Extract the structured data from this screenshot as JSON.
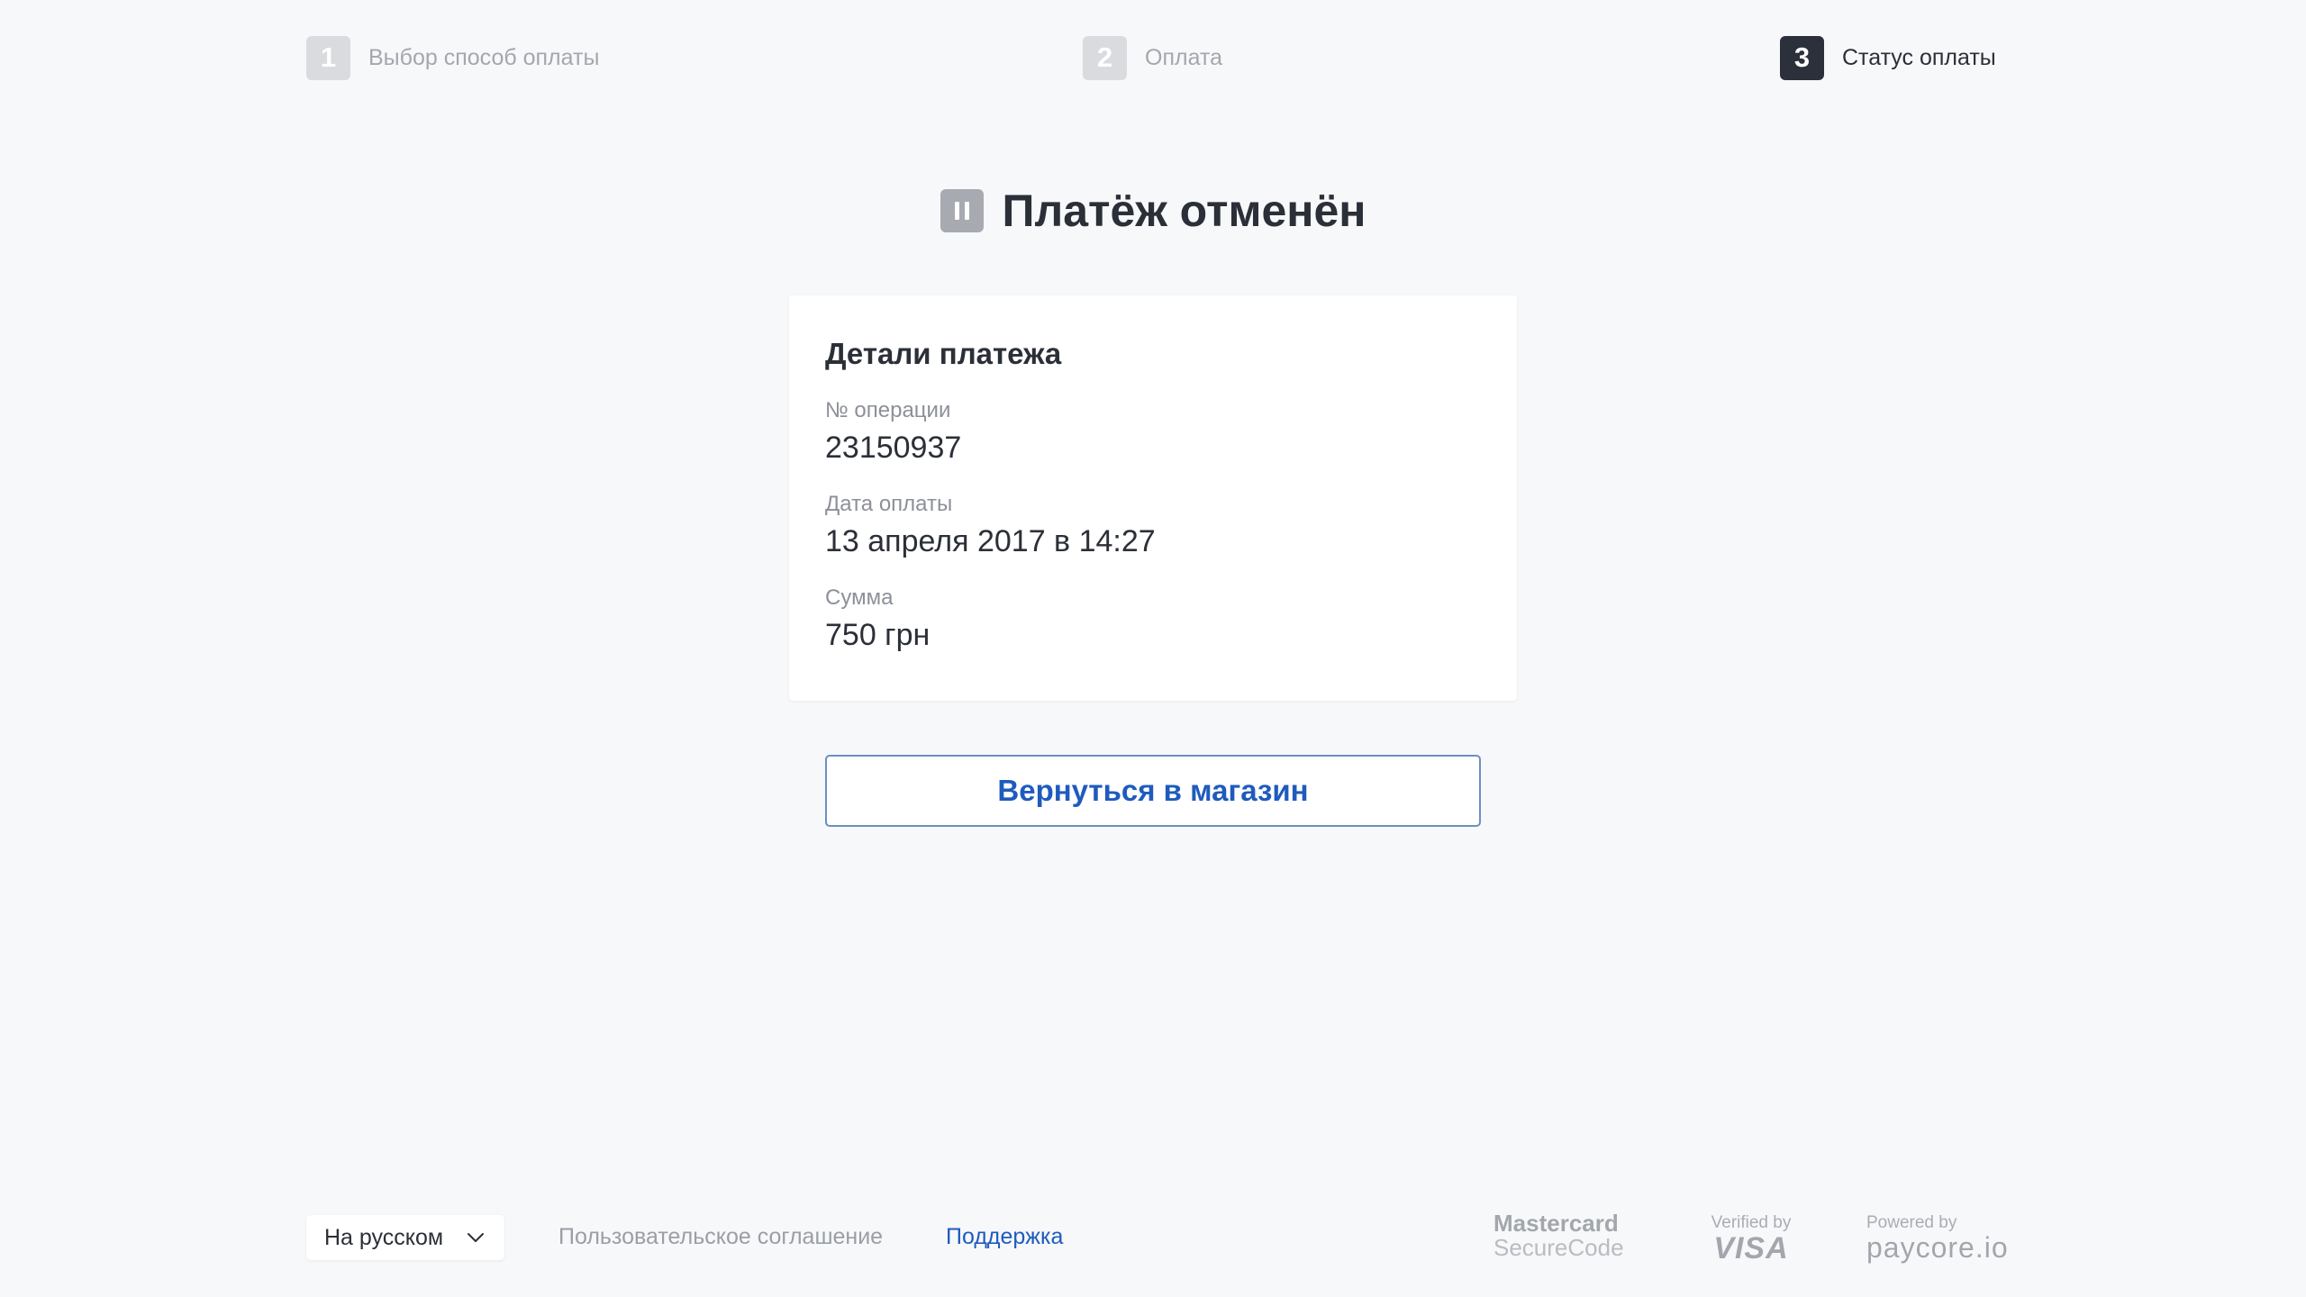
{
  "steps": [
    {
      "number": "1",
      "label": "Выбор способ оплаты",
      "state": "done"
    },
    {
      "number": "2",
      "label": "Оплата",
      "state": "done"
    },
    {
      "number": "3",
      "label": "Статус оплаты",
      "state": "active"
    }
  ],
  "status": {
    "icon": "pause-icon",
    "title": "Платёж отменён"
  },
  "details": {
    "title": "Детали платежа",
    "fields": [
      {
        "label": "№ операции",
        "value": "23150937"
      },
      {
        "label": "Дата оплаты",
        "value": "13 апреля 2017 в 14:27"
      },
      {
        "label": "Сумма",
        "value": "750 грн"
      }
    ]
  },
  "actions": {
    "return_label": "Вернуться в магазин"
  },
  "footer": {
    "language": {
      "selected": "На русском",
      "icon": "chevron-down-icon"
    },
    "terms_label": "Пользовательское соглашение",
    "support_label": "Поддержка",
    "logos": {
      "mastercard": {
        "line1": "Mastercard",
        "line2": "SecureCode"
      },
      "visa": {
        "line1": "Verified by",
        "line2": "VISA"
      },
      "paycore": {
        "line1": "Powered by",
        "line2": "paycore.io"
      }
    }
  },
  "colors": {
    "background": "#f7f8fa",
    "text": "#2b2f38",
    "muted": "#a3a7ae",
    "accent_blue": "#1f5bbd",
    "active_step": "#2b303b",
    "inactive_step": "#d9dbdf"
  }
}
